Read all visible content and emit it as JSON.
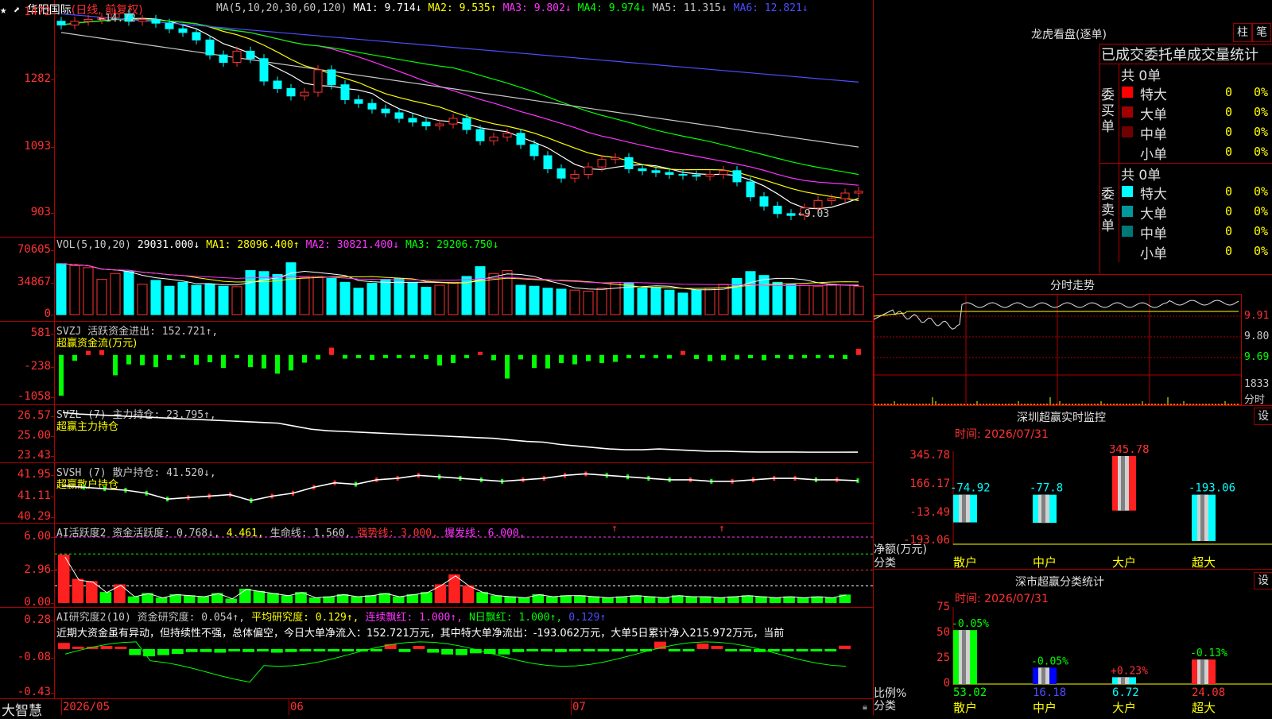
{
  "stock": {
    "name": "华阳国际",
    "period": "(日线, 前复权)"
  },
  "ma_legend": [
    {
      "t": "MA(5,10,20,30,60,120)",
      "c": "#c8c8c8"
    },
    {
      "t": "MA1: 9.714↓",
      "c": "#ffffff"
    },
    {
      "t": "MA2: 9.535↑",
      "c": "#ffff00"
    },
    {
      "t": "MA3: 9.802↓",
      "c": "#ff33ff"
    },
    {
      "t": "MA4: 9.974↓",
      "c": "#00ff00"
    },
    {
      "t": "MA5: 11.315↓",
      "c": "#c8c8c8"
    },
    {
      "t": "MA6: 12.821↓",
      "c": "#4d4dff"
    }
  ],
  "price_axis": [
    "1472",
    "1282",
    "1093",
    "903"
  ],
  "price_marks": {
    "high": "14.72",
    "low": "9.03"
  },
  "vol_legend": [
    {
      "t": "VOL(5,10,20)",
      "c": "#c8c8c8"
    },
    {
      "t": "29031.000↓",
      "c": "#ffffff"
    },
    {
      "t": "MA1: 28096.400↑",
      "c": "#ffff00"
    },
    {
      "t": "MA2: 30821.400↓",
      "c": "#ff33ff"
    },
    {
      "t": "MA3: 29206.750↓",
      "c": "#00ff00"
    }
  ],
  "vol_axis": [
    "70605",
    "34867",
    "0"
  ],
  "svzj": {
    "line1": [
      {
        "t": "SVZJ  活跃资金进出: 152.721↑,",
        "c": "#c8c8c8"
      }
    ],
    "line2": "超赢资金流(万元)",
    "axis": [
      "581",
      "-238",
      "-1058"
    ]
  },
  "svzl": {
    "line1": [
      {
        "t": "SVZL (7) 主力持仓: 23.795↑,",
        "c": "#c8c8c8"
      }
    ],
    "line2": "超赢主力持仓",
    "axis": [
      "26.57",
      "25.00",
      "23.43"
    ]
  },
  "svsh": {
    "line1": [
      {
        "t": "SVSH (7) 散户持仓: 41.520↓,",
        "c": "#c8c8c8"
      }
    ],
    "line2": "超赢散户持仓",
    "axis": [
      "41.95",
      "41.11",
      "40.29"
    ]
  },
  "ai1": {
    "legend": [
      {
        "t": "AI活跃度2 资金活跃度: 0.768↓,",
        "c": "#c8c8c8"
      },
      {
        "t": "4.461,",
        "c": "#ffff00"
      },
      {
        "t": "生命线: 1.560,",
        "c": "#c8c8c8"
      },
      {
        "t": "强势线: 3.000,",
        "c": "#ff3232"
      },
      {
        "t": "爆发线: 6.000,",
        "c": "#ff33ff"
      }
    ],
    "axis": [
      "6.00",
      "2.96",
      "0.00"
    ]
  },
  "ai2": {
    "legend": [
      {
        "t": "AI研究度2(10) 资金研究度: 0.054↑,",
        "c": "#c8c8c8"
      },
      {
        "t": "平均研究度: 0.129↑,",
        "c": "#ffff00"
      },
      {
        "t": "连续飘红: 1.000↑,",
        "c": "#ff33ff"
      },
      {
        "t": "N日飘红: 1.000↑,",
        "c": "#00ff00"
      },
      {
        "t": "0.129↑",
        "c": "#4d4dff"
      }
    ],
    "comment": "近期大资金虽有异动，但持续性不强，总体偏空，今日大单净流入：152.721万元，其中特大单净流出：-193.062万元，大单5日累计净入215.972万元，当前",
    "axis": [
      "0.28",
      "-0.08",
      "-0.43"
    ]
  },
  "date_axis": {
    "brand": "大智慧",
    "labels": [
      "2026/05",
      "06",
      "07"
    ]
  },
  "lhkp": {
    "title": "龙虎看盘(逐单)",
    "tabs": [
      "柱",
      "笔"
    ],
    "subtitle": "已成交委托单成交量统计",
    "buy_label": "委买单",
    "sell_label": "委卖单",
    "buy_total": "共 0单",
    "sell_total": "共 0单",
    "buy_rows": [
      {
        "name": "特大",
        "n": "0",
        "p": "0%",
        "c": "#ff0000"
      },
      {
        "name": "大单",
        "n": "0",
        "p": "0%",
        "c": "#a00000"
      },
      {
        "name": "中单",
        "n": "0",
        "p": "0%",
        "c": "#700000"
      },
      {
        "name": "小单",
        "n": "0",
        "p": "0%",
        "c": "#000000"
      }
    ],
    "sell_rows": [
      {
        "name": "特大",
        "n": "0",
        "p": "0%",
        "c": "#00ffff"
      },
      {
        "name": "大单",
        "n": "0",
        "p": "0%",
        "c": "#009999"
      },
      {
        "name": "中单",
        "n": "0",
        "p": "0%",
        "c": "#007777"
      },
      {
        "name": "小单",
        "n": "0",
        "p": "0%",
        "c": "#000000"
      }
    ]
  },
  "fenshi": {
    "title": "分时走势",
    "axis": [
      "9.91",
      "9.80",
      "9.69"
    ],
    "vol_top": "1833",
    "vol_label": "分时"
  },
  "monitor": {
    "title": "深圳超赢实时监控",
    "button": "设",
    "time": "时间: 2026/07/31",
    "axis": [
      "345.78",
      "166.17",
      "-13.49",
      "-193.06"
    ],
    "ylabel": "净额(万元)",
    "xlabel": "分类",
    "categories": [
      "散户",
      "中户",
      "大户",
      "超大"
    ],
    "values": [
      "-74.92",
      "-77.8",
      "345.78",
      "-193.06"
    ]
  },
  "stats": {
    "title": "深市超赢分类统计",
    "button": "设",
    "time": "时间: 2026/07/31",
    "axis": [
      "75",
      "50",
      "25",
      "0"
    ],
    "ylabel": "比例%",
    "xlabel": "分类",
    "categories": [
      "散户",
      "中户",
      "大户",
      "超大"
    ],
    "changes": [
      "-0.05%",
      "-0.05%",
      "+0.23%",
      "-0.13%"
    ],
    "values": [
      "53.02",
      "16.18",
      "6.72",
      "24.08"
    ]
  },
  "chart_data": [
    {
      "type": "candlestick",
      "title": "华阳国际 (日线, 前复权)",
      "ylim": [
        9.03,
        14.72
      ],
      "x": [
        "2026/05",
        "06",
        "07"
      ],
      "series": [
        {
          "name": "close",
          "values": [
            14.4,
            14.5,
            14.55,
            14.6,
            14.7,
            14.5,
            14.55,
            14.45,
            14.3,
            14.2,
            14.0,
            13.6,
            13.4,
            13.7,
            13.5,
            12.9,
            12.7,
            12.5,
            12.6,
            13.2,
            12.8,
            12.4,
            12.3,
            12.15,
            12.05,
            11.9,
            11.8,
            11.7,
            11.75,
            11.9,
            11.6,
            11.3,
            11.4,
            11.5,
            11.2,
            10.9,
            10.55,
            10.3,
            10.4,
            10.6,
            10.8,
            10.85,
            10.55,
            10.5,
            10.45,
            10.4,
            10.38,
            10.35,
            10.4,
            10.5,
            10.2,
            9.8,
            9.55,
            9.35,
            9.3,
            9.5,
            9.7,
            9.75,
            9.9,
            9.95
          ]
        }
      ],
      "ma": {
        "MA1": 9.714,
        "MA2": 9.535,
        "MA3": 9.802,
        "MA4": 9.974,
        "MA5": 11.315,
        "MA6": 12.821
      }
    },
    {
      "type": "bar",
      "title": "VOL(5,10,20)",
      "ylim": [
        0,
        70605
      ],
      "series": [
        {
          "name": "VOL",
          "values": [
            52000,
            50000,
            48000,
            36000,
            42000,
            44000,
            31000,
            35000,
            29000,
            33000,
            30000,
            31000,
            29000,
            28500,
            45000,
            44000,
            41000,
            53000,
            38000,
            39000,
            37000,
            33000,
            27000,
            32000,
            36000,
            37000,
            33000,
            28000,
            30000,
            33000,
            39000,
            49000,
            42000,
            45000,
            30000,
            29000,
            27000,
            26000,
            25000,
            24000,
            27000,
            33000,
            32000,
            27000,
            28000,
            25000,
            22000,
            25000,
            27000,
            31000,
            37000,
            44000,
            40000,
            33000,
            31000,
            30000,
            29000,
            31000,
            30000,
            29031
          ]
        }
      ]
    },
    {
      "type": "bar",
      "title": "超赢资金流(万元)",
      "ylim": [
        -1058,
        581
      ],
      "series": [
        {
          "name": "活跃资金进出",
          "values": [
            -1000,
            -140,
            100,
            120,
            -500,
            -230,
            -250,
            -300,
            -120,
            -80,
            -240,
            -180,
            -320,
            -70,
            -300,
            -330,
            -460,
            -380,
            -190,
            -110,
            180,
            -90,
            -60,
            -120,
            -70,
            -60,
            -50,
            -100,
            -260,
            -200,
            -70,
            50,
            -130,
            -580,
            -110,
            -320,
            -330,
            -200,
            -230,
            -150,
            -200,
            -170,
            -60,
            -70,
            -60,
            -90,
            100,
            -100,
            -150,
            -130,
            -110,
            -80,
            -130,
            -60,
            -100,
            -60,
            -60,
            -60,
            -100,
            152.721
          ]
        }
      ]
    },
    {
      "type": "line",
      "title": "超赢主力持仓",
      "ylim": [
        23.43,
        26.57
      ],
      "series": [
        {
          "name": "主力持仓",
          "values": [
            26.4,
            26.3,
            26.25,
            26.2,
            26.15,
            26.1,
            26.05,
            26.0,
            25.95,
            25.9,
            25.85,
            25.8,
            25.75,
            25.7,
            25.5,
            25.3,
            25.2,
            25.15,
            25.1,
            25.05,
            25.0,
            24.95,
            24.9,
            24.85,
            24.8,
            24.75,
            24.7,
            24.6,
            24.5,
            24.45,
            24.3,
            24.2,
            24.1,
            24.0,
            23.95,
            23.95,
            24.0,
            23.95,
            23.9,
            23.85,
            23.85,
            23.82,
            23.8,
            23.8,
            23.8,
            23.79,
            23.79,
            23.79,
            23.795
          ]
        }
      ]
    },
    {
      "type": "line",
      "title": "超赢散户持仓",
      "ylim": [
        40.29,
        41.95
      ],
      "series": [
        {
          "name": "散户持仓",
          "values": [
            41.35,
            41.3,
            41.25,
            41.2,
            41.1,
            40.9,
            40.95,
            41.0,
            41.05,
            40.85,
            41.0,
            41.1,
            41.3,
            41.45,
            41.4,
            41.55,
            41.6,
            41.7,
            41.65,
            41.6,
            41.55,
            41.5,
            41.55,
            41.6,
            41.7,
            41.75,
            41.7,
            41.65,
            41.6,
            41.55,
            41.55,
            41.5,
            41.5,
            41.55,
            41.6,
            41.6,
            41.55,
            41.55,
            41.52
          ]
        }
      ]
    },
    {
      "type": "bar",
      "title": "AI活跃度2",
      "ylim": [
        0,
        6.0
      ],
      "series": [
        {
          "name": "资金活跃度",
          "values": [
            4.4,
            2.2,
            2.0,
            1.0,
            1.7,
            0.6,
            0.9,
            0.5,
            0.8,
            0.7,
            0.6,
            0.9,
            0.4,
            1.3,
            1.1,
            0.9,
            0.7,
            1.0,
            0.5,
            0.6,
            0.8,
            0.6,
            0.7,
            0.9,
            0.6,
            0.8,
            1.0,
            1.7,
            2.6,
            1.6,
            1.0,
            0.7,
            0.6,
            0.5,
            0.8,
            0.6,
            0.7,
            0.7,
            0.6,
            0.5,
            0.6,
            0.7,
            0.6,
            0.5,
            0.7,
            0.6,
            0.6,
            0.5,
            0.6,
            0.7,
            0.6,
            0.5,
            0.6,
            0.5,
            0.6,
            0.5,
            0.768
          ]
        }
      ]
    },
    {
      "type": "bar",
      "title": "AI研究度2(10)",
      "ylim": [
        -0.43,
        0.28
      ],
      "series": [
        {
          "name": "资金研究度",
          "values": [
            0.1,
            0.0,
            0.0,
            0.05,
            0.0,
            -0.1,
            -0.12,
            -0.1,
            -0.08,
            -0.05,
            -0.05,
            -0.06,
            -0.03,
            -0.05,
            -0.04,
            -0.06,
            -0.05,
            -0.03,
            -0.03,
            -0.04,
            -0.03,
            -0.04,
            -0.02,
            0.08,
            -0.05,
            0.05,
            -0.06,
            -0.09,
            -0.1,
            -0.07,
            -0.08,
            -0.09,
            -0.05,
            -0.03,
            -0.03,
            -0.05,
            -0.02,
            -0.02,
            -0.03,
            -0.03,
            -0.02,
            -0.03,
            0.12,
            -0.03,
            -0.02,
            0.09,
            0.05,
            -0.03,
            -0.04,
            -0.05,
            -0.04,
            -0.03,
            -0.04,
            -0.03,
            -0.03,
            0.054
          ]
        }
      ]
    },
    {
      "type": "bar",
      "title": "深圳超赢实时监控",
      "categories": [
        "散户",
        "中户",
        "大户",
        "超大"
      ],
      "values": [
        -74.92,
        -77.8,
        345.78,
        -193.06
      ],
      "ylabel": "净额(万元)",
      "ylim": [
        -193.06,
        345.78
      ]
    },
    {
      "type": "bar",
      "title": "深市超赢分类统计",
      "categories": [
        "散户",
        "中户",
        "大户",
        "超大"
      ],
      "values": [
        53.02,
        16.18,
        6.72,
        24.08
      ],
      "ylabel": "比例%",
      "ylim": [
        0,
        75
      ]
    }
  ]
}
